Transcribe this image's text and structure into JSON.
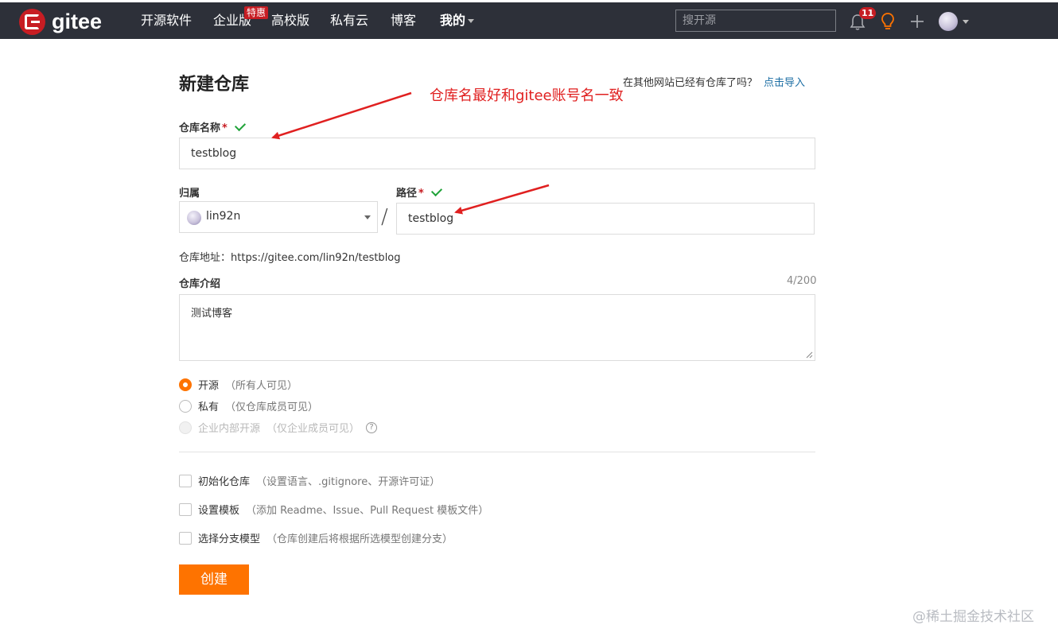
{
  "brand": {
    "name": "gitee"
  },
  "nav": {
    "items": [
      "开源软件",
      "企业版",
      "高校版",
      "私有云",
      "博客",
      "我的"
    ],
    "hot_badge": "特惠",
    "search_placeholder": "搜开源",
    "notification_count": "11"
  },
  "page": {
    "title": "新建仓库",
    "import_prompt": "在其他网站已经有仓库了吗？",
    "import_link": "点击导入"
  },
  "form": {
    "repo_name_label": "仓库名称",
    "repo_name_value": "testblog",
    "required_mark": "*",
    "owner_label": "归属",
    "owner_value": "lin92n",
    "path_label": "路径",
    "path_value": "testblog",
    "slash": "/",
    "repo_url_label": "仓库地址：",
    "repo_url_value": "https://gitee.com/lin92n/testblog",
    "desc_label": "仓库介绍",
    "desc_counter": "4/200",
    "desc_value": "测试博客",
    "visibility": [
      {
        "label": "开源",
        "hint": "（所有人可见）",
        "state": "selected"
      },
      {
        "label": "私有",
        "hint": "（仅仓库成员可见）",
        "state": "unselected"
      },
      {
        "label": "企业内部开源",
        "hint": "（仅企业成员可见）",
        "state": "disabled"
      }
    ],
    "help_glyph": "?",
    "options": [
      {
        "label": "初始化仓库",
        "hint": "（设置语言、.gitignore、开源许可证）"
      },
      {
        "label": "设置模板",
        "hint": "（添加 Readme、Issue、Pull Request 模板文件）"
      },
      {
        "label": "选择分支模型",
        "hint": "（仓库创建后将根据所选模型创建分支）"
      }
    ],
    "submit_label": "创建"
  },
  "annotation": {
    "text": "仓库名最好和gitee账号名一致",
    "color": "#e02020"
  },
  "watermark": "@稀土掘金技术社区",
  "colors": {
    "navbar": "#2d3039",
    "brand_red": "#c71d23",
    "accent_orange": "#fe7300",
    "link_blue": "#1c6ea4",
    "valid_green": "#21a33a"
  }
}
